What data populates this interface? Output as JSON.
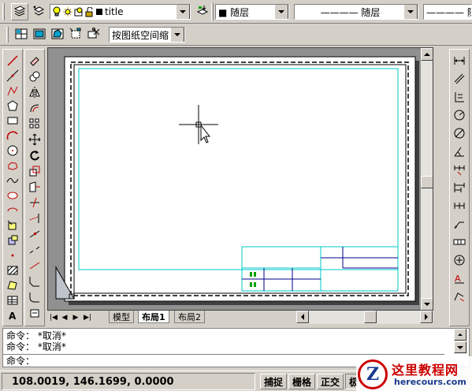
{
  "layer_bar": {
    "layer_name": "title",
    "color_value": "■ 随层",
    "linetype_value": "———— 随层",
    "lineweight_value": "———— 随"
  },
  "viewport_bar": {
    "scale_value": "按图纸空间缩"
  },
  "layout_tabs": [
    {
      "label": "模型",
      "active": false
    },
    {
      "label": "布局1",
      "active": true
    },
    {
      "label": "布局2",
      "active": false
    }
  ],
  "command_history": [
    "命令： *取消*",
    "命令： *取消*"
  ],
  "command_prompt": "命令：",
  "status": {
    "coordinates": "108.0019, 146.1699, 0.0000",
    "snap": "捕捉",
    "grid": "栅格",
    "ortho": "正交",
    "polar": "极"
  },
  "watermark": {
    "title": "这里教程网",
    "url": "herecours.com",
    "letter": "Z"
  },
  "colors": {
    "face": "#d4d0c8",
    "paper_bg": "#909090",
    "sheet": "#ffffff",
    "margin_line": "#00c8c8",
    "titleblock_line": "#00008b",
    "watermark_red": "#cc0000",
    "watermark_blue": "#1a3a8c"
  },
  "icons": {
    "draw_toolbar": [
      "line-icon",
      "construction-line-icon",
      "polyline-icon",
      "polygon-icon",
      "rectangle-icon",
      "arc-icon",
      "circle-icon",
      "revcloud-icon",
      "spline-icon",
      "ellipse-icon",
      "ellipse-arc-icon",
      "insert-block-icon",
      "make-block-icon",
      "point-icon",
      "hatch-icon",
      "region-icon",
      "table-icon",
      "multiline-text-icon"
    ],
    "modify_toolbar": [
      "erase-icon",
      "copy-icon",
      "mirror-icon",
      "offset-icon",
      "array-icon",
      "move-icon",
      "rotate-icon",
      "scale-icon",
      "stretch-icon",
      "trim-icon",
      "extend-icon",
      "break-at-point-icon",
      "break-icon",
      "join-icon",
      "chamfer-icon",
      "fillet-icon",
      "explode-icon"
    ],
    "dimension_toolbar": [
      "linear-dim-icon",
      "aligned-dim-icon",
      "ordinate-dim-icon",
      "radius-dim-icon",
      "diameter-dim-icon",
      "angular-dim-icon",
      "quick-dim-icon",
      "baseline-dim-icon",
      "continue-dim-icon",
      "qleader-icon",
      "tolerance-icon",
      "center-mark-icon",
      "dimedit-icon",
      "dimtedit-icon"
    ]
  }
}
